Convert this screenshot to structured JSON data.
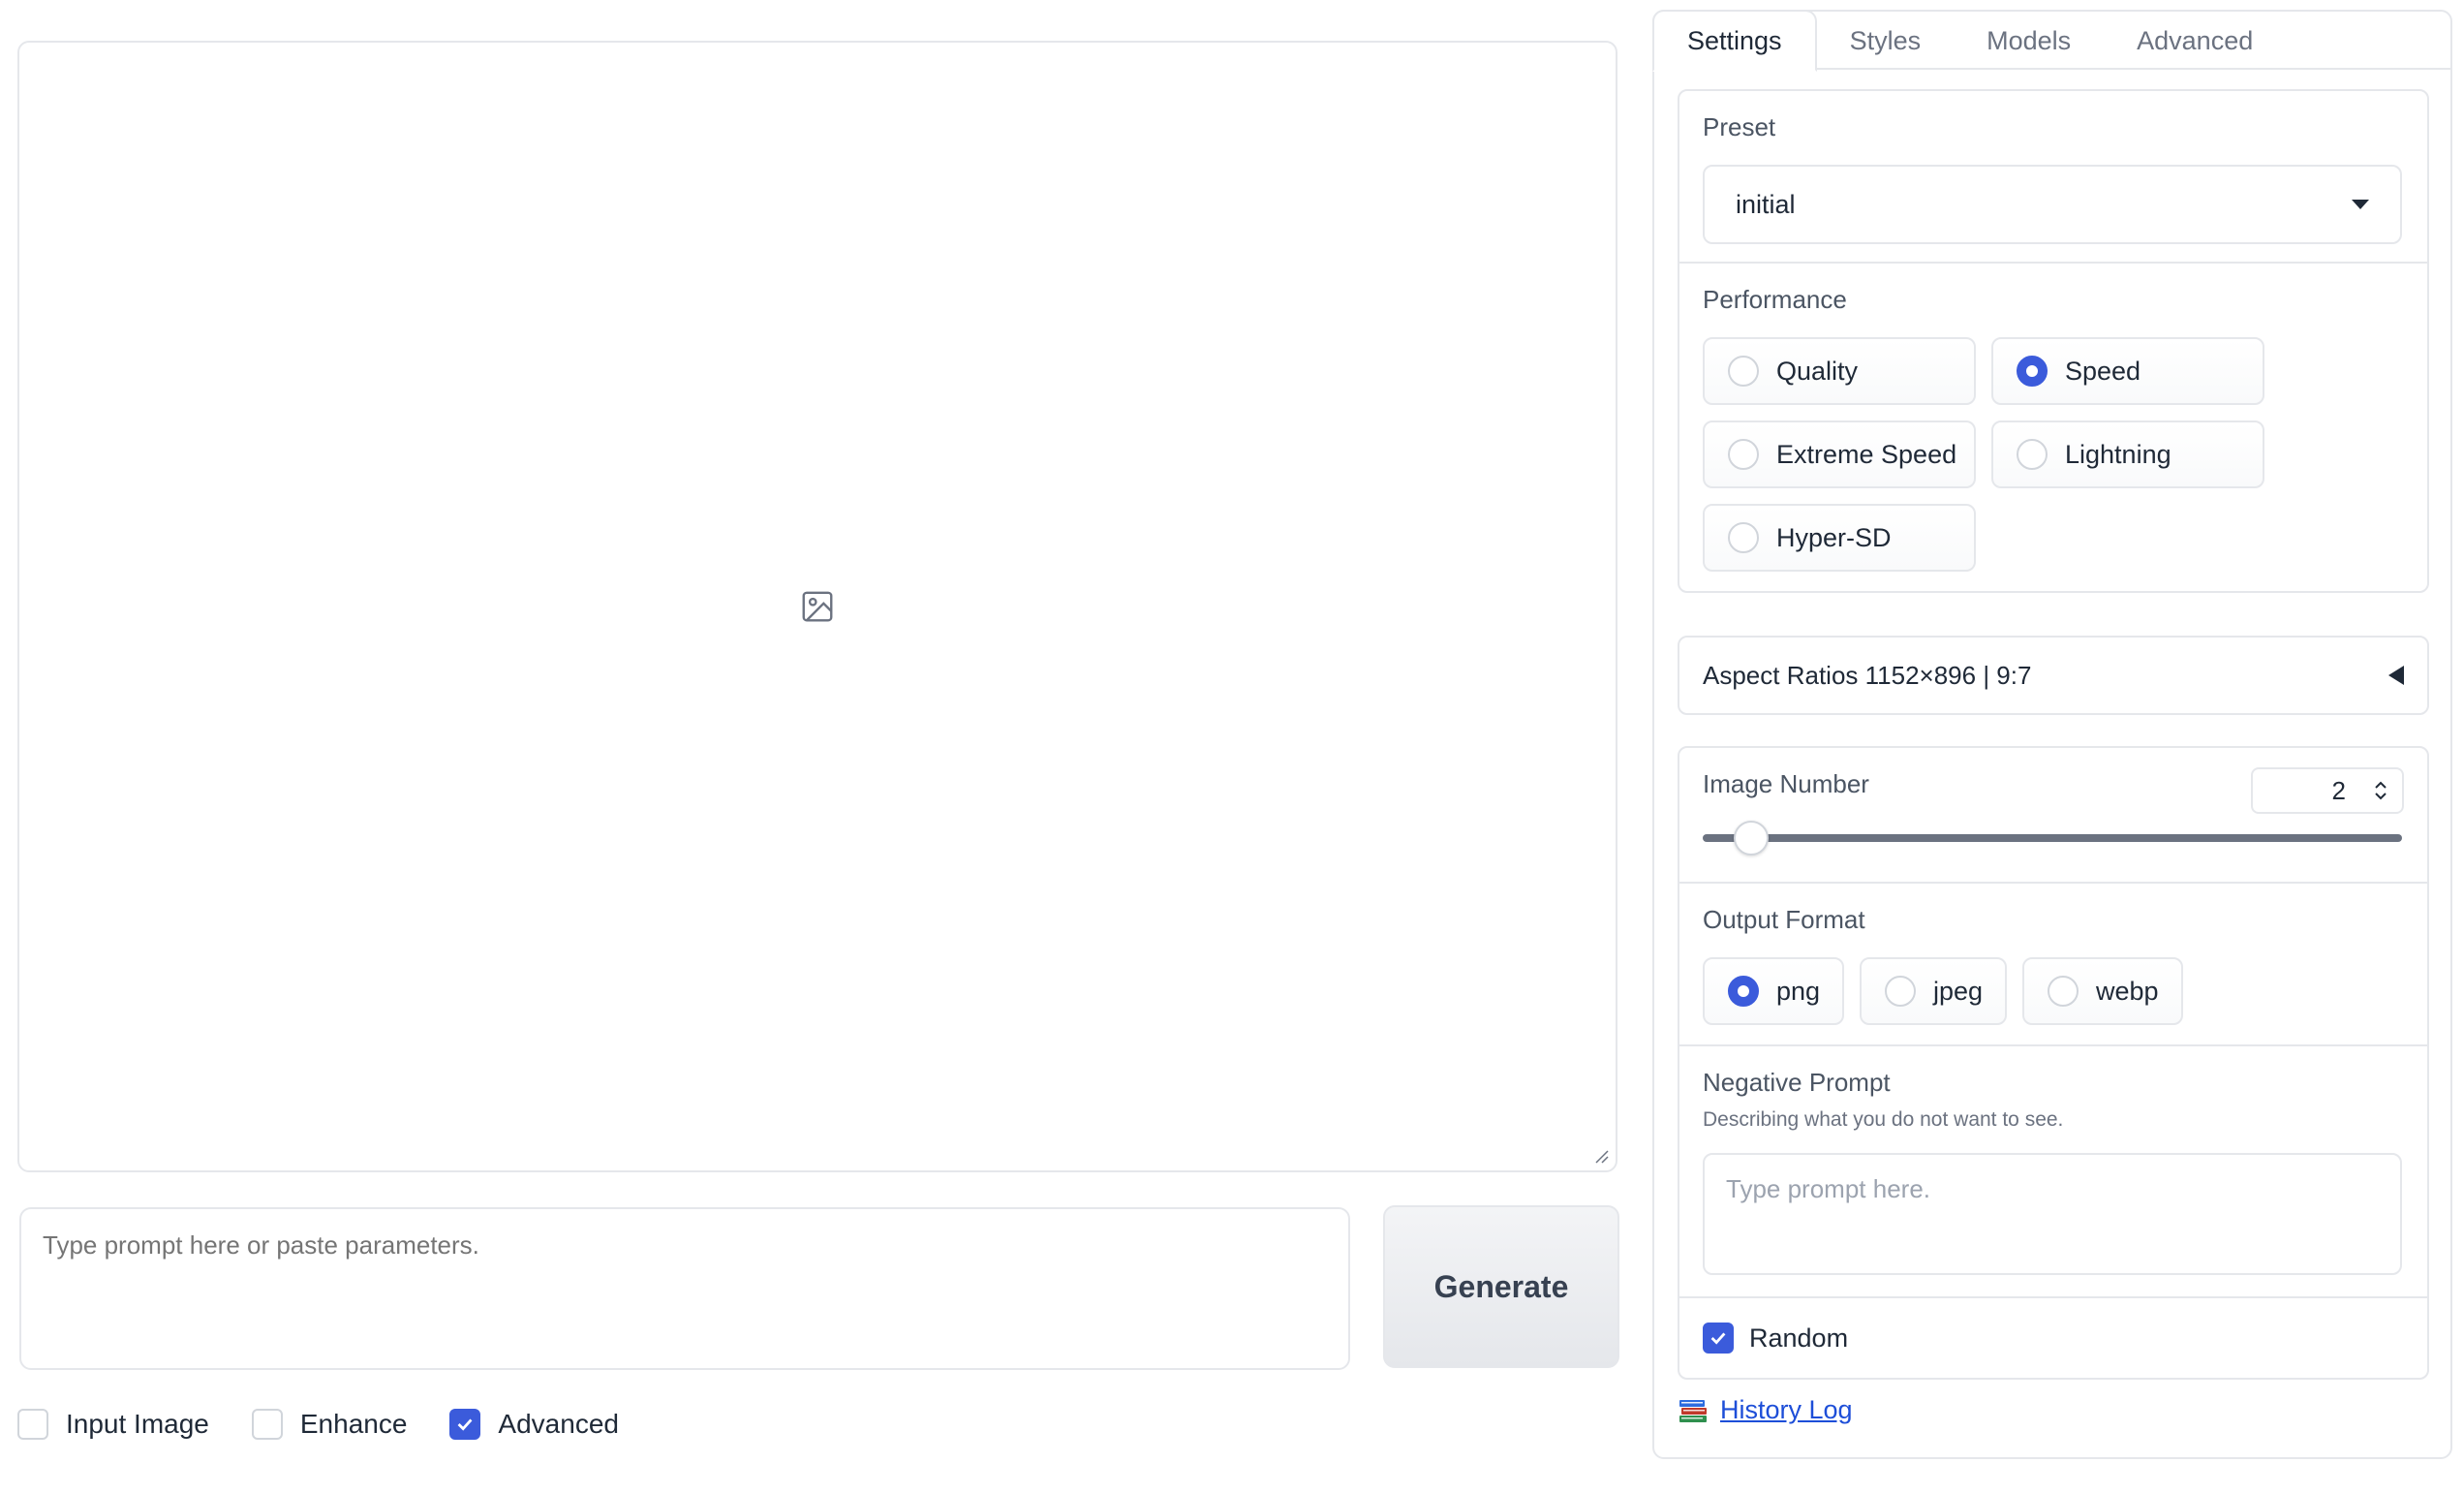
{
  "main": {
    "gallery": {
      "icon": "image-icon"
    },
    "prompt": {
      "placeholder": "Type prompt here or paste parameters."
    },
    "generate_label": "Generate",
    "checkboxes": [
      {
        "label": "Input Image",
        "checked": false
      },
      {
        "label": "Enhance",
        "checked": false
      },
      {
        "label": "Advanced",
        "checked": true
      }
    ]
  },
  "panel": {
    "tabs": [
      {
        "label": "Settings",
        "active": true
      },
      {
        "label": "Styles",
        "active": false
      },
      {
        "label": "Models",
        "active": false
      },
      {
        "label": "Advanced",
        "active": false
      }
    ],
    "preset": {
      "label": "Preset",
      "value": "initial"
    },
    "performance": {
      "label": "Performance",
      "options": [
        {
          "label": "Quality",
          "selected": false
        },
        {
          "label": "Speed",
          "selected": true
        },
        {
          "label": "Extreme Speed",
          "selected": false
        },
        {
          "label": "Lightning",
          "selected": false
        },
        {
          "label": "Hyper-SD",
          "selected": false
        }
      ]
    },
    "aspect_ratios": {
      "label": "Aspect Ratios 1152×896 | 9:7"
    },
    "image_number": {
      "label": "Image Number",
      "value": "2",
      "min": 1,
      "max": 32
    },
    "output_format": {
      "label": "Output Format",
      "options": [
        {
          "label": "png",
          "selected": true
        },
        {
          "label": "jpeg",
          "selected": false
        },
        {
          "label": "webp",
          "selected": false
        }
      ]
    },
    "negative_prompt": {
      "label": "Negative Prompt",
      "info": "Describing what you do not want to see.",
      "placeholder": "Type prompt here."
    },
    "random": {
      "label": "Random",
      "checked": true
    },
    "history_link": "History Log"
  },
  "colors": {
    "accent": "#3b5bdb",
    "border": "#e5e7eb",
    "link": "#1d4ed8"
  }
}
